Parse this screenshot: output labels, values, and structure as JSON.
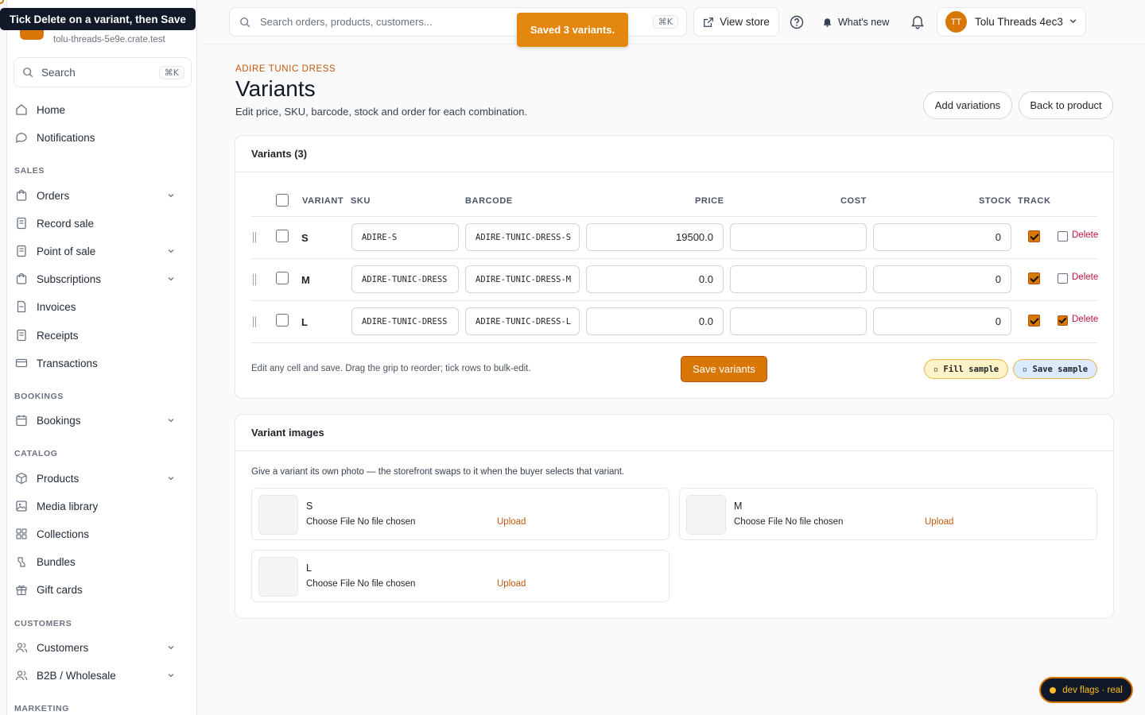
{
  "tour": {
    "tip": "Tick Delete on a variant, then Save"
  },
  "sidebar": {
    "store_domain": "tolu-threads-5e9e.crate.test",
    "search_label": "Search",
    "search_kbd": "⌘K",
    "items": [
      {
        "label": "Home",
        "icon": "home-icon"
      },
      {
        "label": "Notifications",
        "icon": "chat-bubble-icon"
      },
      {
        "label": "Orders",
        "icon": "shopping-bag-icon"
      },
      {
        "label": "Record sale",
        "icon": "receipt-icon"
      },
      {
        "label": "Point of sale",
        "icon": "receipt-icon"
      },
      {
        "label": "Subscriptions",
        "icon": "shopping-bag-icon"
      },
      {
        "label": "Invoices",
        "icon": "document-icon"
      },
      {
        "label": "Receipts",
        "icon": "receipt-icon"
      },
      {
        "label": "Transactions",
        "icon": "credit-card-icon"
      },
      {
        "label": "Bookings",
        "icon": "calendar-icon"
      },
      {
        "label": "Products",
        "icon": "cube-icon"
      },
      {
        "label": "Media library",
        "icon": "image-icon"
      },
      {
        "label": "Collections",
        "icon": "grid-icon"
      },
      {
        "label": "Bundles",
        "icon": "bundle-icon"
      },
      {
        "label": "Gift cards",
        "icon": "gift-icon"
      },
      {
        "label": "Customers",
        "icon": "users-icon"
      },
      {
        "label": "B2B / Wholesale",
        "icon": "users-icon"
      }
    ],
    "sections": [
      "SALES",
      "BOOKINGS",
      "CATALOG",
      "CUSTOMERS",
      "MARKETING"
    ]
  },
  "topbar": {
    "search_placeholder": "Search orders, products, customers...",
    "search_kbd": "⌘K",
    "view_store": "View store",
    "whats_new": "What's new",
    "avatar_initials": "TT",
    "account_name": "Tolu Threads 4ec3"
  },
  "toast": "Saved 3 variants.",
  "page": {
    "eyebrow": "ADIRE TUNIC DRESS",
    "title": "Variants",
    "subtitle": "Edit price, SKU, barcode, stock and order for each combination.",
    "add_variations": "Add variations",
    "back_to_product": "Back to product"
  },
  "variants_card": {
    "heading": "Variants (3)",
    "columns": {
      "variant": "VARIANT",
      "sku": "SKU",
      "barcode": "BARCODE",
      "price": "PRICE",
      "cost": "COST",
      "stock": "STOCK",
      "track": "TRACK"
    },
    "rows": [
      {
        "name": "S",
        "sku": "ADIRE-S",
        "barcode": "ADIRE-TUNIC-DRESS-S",
        "price": "19500.0",
        "cost": "",
        "stock": "0",
        "track": true,
        "delete": false,
        "delete_label": "Delete"
      },
      {
        "name": "M",
        "sku": "ADIRE-TUNIC-DRESS",
        "barcode": "ADIRE-TUNIC-DRESS-M",
        "price": "0.0",
        "cost": "",
        "stock": "0",
        "track": true,
        "delete": false,
        "delete_label": "Delete"
      },
      {
        "name": "L",
        "sku": "ADIRE-TUNIC-DRESS",
        "barcode": "ADIRE-TUNIC-DRESS-L",
        "price": "0.0",
        "cost": "",
        "stock": "0",
        "track": true,
        "delete": true,
        "delete_label": "Delete"
      }
    ],
    "footnote": "Edit any cell and save. Drag the grip to reorder; tick rows to bulk-edit.",
    "save_label": "Save variants",
    "fill_sample": "▫ Fill sample",
    "save_sample": "▫ Save sample"
  },
  "images_card": {
    "heading": "Variant images",
    "intro": "Give a variant its own photo — the storefront swaps to it when the buyer selects that variant.",
    "tiles": [
      {
        "name": "S",
        "file": "Choose File  No file chosen",
        "upload": "Upload"
      },
      {
        "name": "M",
        "file": "Choose File  No file chosen",
        "upload": "Upload"
      },
      {
        "name": "L",
        "file": "Choose File  No file chosen",
        "upload": "Upload"
      }
    ]
  },
  "dev_flag": "dev flags · real",
  "colors": {
    "accent": "#d97706",
    "accent_text": "#c2570c",
    "danger": "#be123c"
  }
}
